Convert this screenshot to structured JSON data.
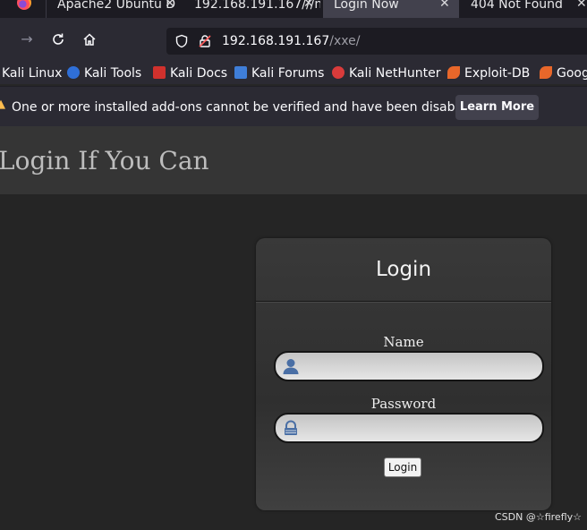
{
  "browser": {
    "tabs": [
      {
        "title": "Apache2 Ubuntu D",
        "active": false
      },
      {
        "title": "192.168.191.167///n",
        "active": false
      },
      {
        "title": "Login Now",
        "active": true
      },
      {
        "title": "404 Not Found",
        "active": false
      }
    ],
    "close_glyph": "✕",
    "url_host": "192.168.191.167",
    "url_path": "/xxe/",
    "bookmarks": [
      {
        "label": "Kali Linux",
        "color": "#2f6fd8"
      },
      {
        "label": "Kali Tools",
        "color": "#e84c3d"
      },
      {
        "label": "Kali Docs",
        "color": "#d0312d"
      },
      {
        "label": "Kali Forums",
        "color": "#3f7ed8"
      },
      {
        "label": "Kali NetHunter",
        "color": "#d93b3b"
      },
      {
        "label": "Exploit-DB",
        "color": "#e8672a"
      },
      {
        "label": "Goog",
        "color": "#e8672a"
      }
    ],
    "notification": {
      "message": "One or more installed add-ons cannot be verified and have been disabled.",
      "button": "Learn More"
    }
  },
  "page": {
    "header_title": "Login If You Can",
    "panel_title": "Login",
    "name_label": "Name",
    "password_label": "Password",
    "name_value": "",
    "password_value": "",
    "submit_label": "Login"
  },
  "watermark": "CSDN @☆firefly☆"
}
